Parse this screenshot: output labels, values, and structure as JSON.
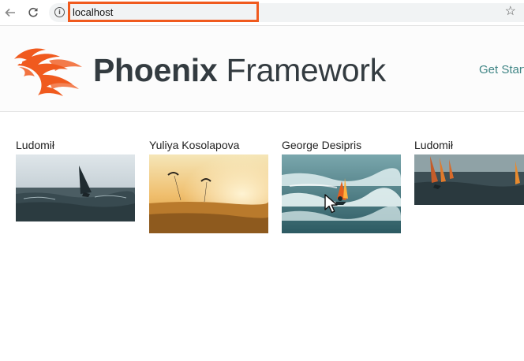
{
  "browser": {
    "url": "localhost",
    "back_icon": "arrow-left-icon",
    "reload_icon": "reload-icon",
    "info_icon": "info-icon",
    "bookmark_icon": "star-icon",
    "highlight_color": "#f05a1e"
  },
  "header": {
    "brand_bold": "Phoenix",
    "brand_light": " Framework",
    "nav_link": "Get Start",
    "logo_color": "#f05a1e",
    "link_color": "#3f8585"
  },
  "gallery": {
    "photos": [
      {
        "author": "Ludomił",
        "scene": "windsurfer on dark sea"
      },
      {
        "author": "Yuliya Kosolapova",
        "scene": "kitesurfers at golden sunset"
      },
      {
        "author": "George Desipris",
        "scene": "windsurfer in waves"
      },
      {
        "author": "Ludomił",
        "scene": "windsurfing sails on dark sea"
      }
    ]
  }
}
